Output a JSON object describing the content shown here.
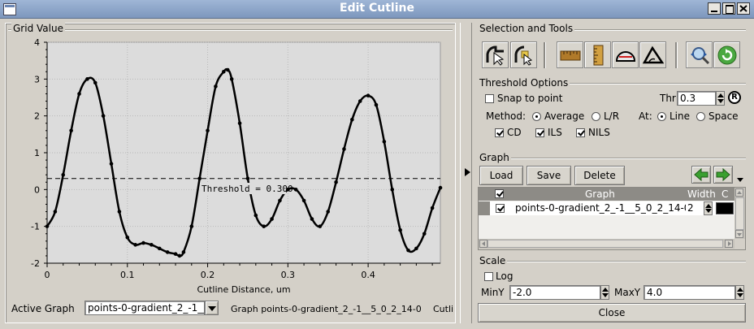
{
  "window": {
    "title": "Edit Cutline"
  },
  "plot": {
    "group_label": "Grid Value",
    "xlabel": "Cutline Distance, um",
    "threshold_label": "Threshold = 0.300",
    "y_ticks": [
      "4",
      "3",
      "2",
      "1",
      "0",
      "-1",
      "-2"
    ],
    "x_ticks": [
      "0",
      "0.1",
      "0.2",
      "0.3",
      "0.4"
    ],
    "active_graph_label": "Active Graph",
    "active_graph_value": "points-0-gradient_2_-1__",
    "graph_status": "Graph  points-0-gradient_2_-1__5_0_2_14-0",
    "cutline_status": "Cutli"
  },
  "chart_data": {
    "type": "line",
    "title": "",
    "xlabel": "Cutline Distance, um",
    "ylabel": "Grid Value",
    "xlim": [
      0,
      0.49
    ],
    "ylim": [
      -2,
      4
    ],
    "threshold": 0.3,
    "grid": true,
    "series": [
      {
        "name": "points-0-gradient_2_-1__5_0_2_14-0",
        "color": "#000000",
        "x": [
          0,
          0.01,
          0.02,
          0.03,
          0.04,
          0.05,
          0.06,
          0.07,
          0.08,
          0.09,
          0.1,
          0.11,
          0.12,
          0.13,
          0.14,
          0.15,
          0.16,
          0.165,
          0.17,
          0.18,
          0.19,
          0.2,
          0.21,
          0.22,
          0.225,
          0.23,
          0.24,
          0.25,
          0.26,
          0.27,
          0.28,
          0.29,
          0.3,
          0.31,
          0.32,
          0.33,
          0.34,
          0.35,
          0.36,
          0.37,
          0.38,
          0.39,
          0.4,
          0.41,
          0.42,
          0.43,
          0.44,
          0.45,
          0.46,
          0.47,
          0.48,
          0.49
        ],
        "values": [
          -1.0,
          -0.6,
          0.4,
          1.6,
          2.6,
          3.0,
          2.9,
          2.0,
          0.7,
          -0.6,
          -1.3,
          -1.5,
          -1.45,
          -1.5,
          -1.6,
          -1.7,
          -1.75,
          -1.8,
          -1.7,
          -1.0,
          0.3,
          1.6,
          2.8,
          3.2,
          3.25,
          3.0,
          1.8,
          0.3,
          -0.7,
          -1.0,
          -0.8,
          -0.3,
          0.0,
          0.0,
          -0.3,
          -0.8,
          -1.0,
          -0.6,
          0.2,
          1.1,
          1.9,
          2.4,
          2.55,
          2.3,
          1.3,
          0.0,
          -1.1,
          -1.65,
          -1.6,
          -1.2,
          -0.5,
          0.05
        ]
      }
    ]
  },
  "tools": {
    "section_label": "Selection and Tools",
    "items": [
      "select-arrow-icon",
      "select-point-icon",
      "ruler-horizontal-icon",
      "ruler-vertical-icon",
      "protractor-icon",
      "angle-icon",
      "zoom-icon",
      "reset-icon"
    ]
  },
  "threshold_options": {
    "section_label": "Threshold Options",
    "snap_label": "Snap to point",
    "snap_checked": false,
    "thr_label": "Thr",
    "thr_value": "0.3",
    "method_label": "Method:",
    "method_options": [
      "Average",
      "L/R"
    ],
    "method_selected": "Average",
    "at_label": "At:",
    "at_options": [
      "Line",
      "Space"
    ],
    "at_selected": "Line",
    "metrics": [
      {
        "label": "CD",
        "checked": true
      },
      {
        "label": "ILS",
        "checked": true
      },
      {
        "label": "NILS",
        "checked": true
      }
    ]
  },
  "graph": {
    "section_label": "Graph",
    "load_label": "Load",
    "save_label": "Save",
    "delete_label": "Delete",
    "columns": [
      "Graph",
      "Width",
      "C"
    ],
    "rows": [
      {
        "checked": true,
        "name": "points-0-gradient_2_-1__5_0_2_14-0",
        "width": "2",
        "color": "#000000"
      }
    ]
  },
  "scale": {
    "section_label": "Scale",
    "log_label": "Log",
    "log_checked": false,
    "miny_label": "MinY",
    "miny_value": "-2.0",
    "maxy_label": "MaxY",
    "maxy_value": "4.0"
  },
  "close_label": "Close"
}
